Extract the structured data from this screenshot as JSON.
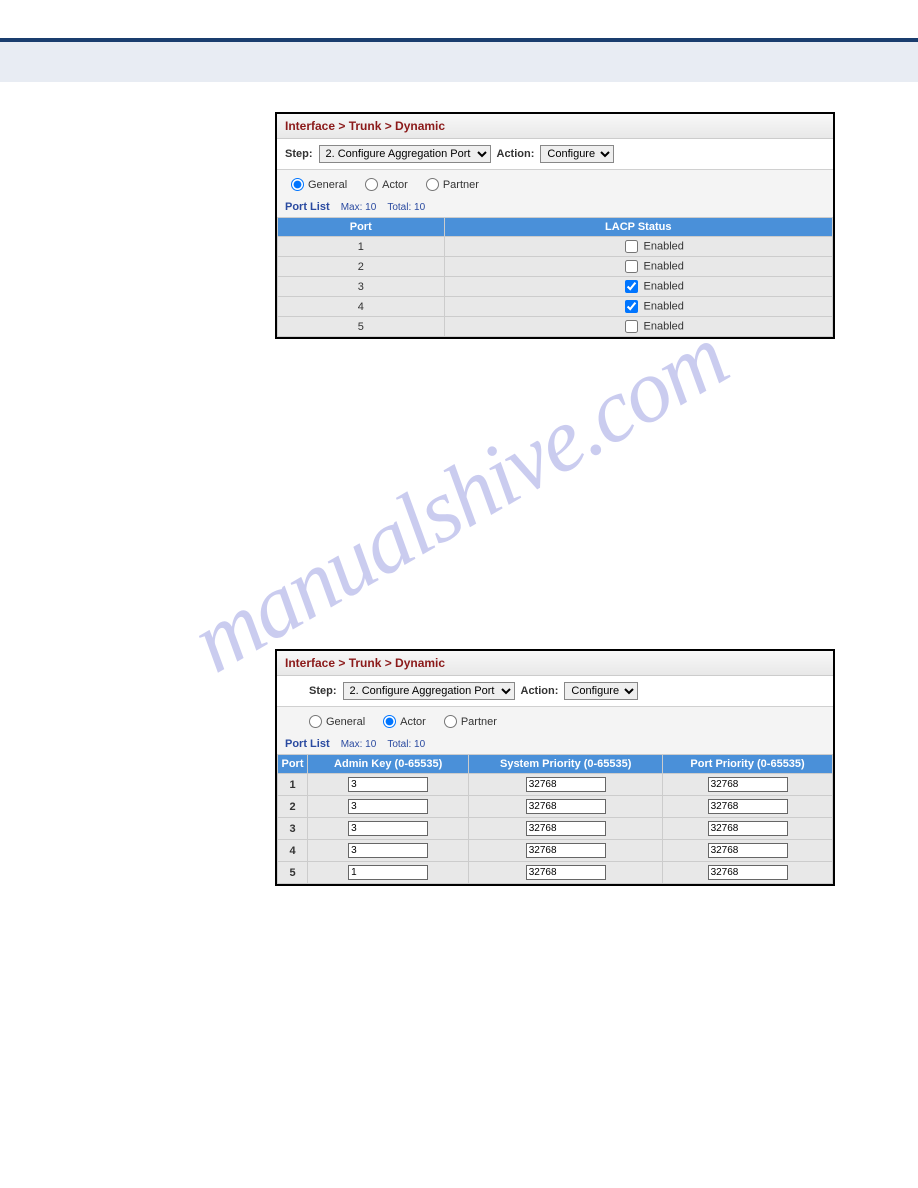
{
  "breadcrumb": "Interface > Trunk > Dynamic",
  "stepbar": {
    "step_label": "Step:",
    "step_value": "2. Configure Aggregation Port",
    "action_label": "Action:",
    "action_value": "Configure"
  },
  "radios": {
    "general": "General",
    "actor": "Actor",
    "partner": "Partner"
  },
  "portlist": {
    "title": "Port List",
    "max": "Max: 10",
    "total": "Total: 10"
  },
  "panel1": {
    "headers": {
      "port": "Port",
      "lacp": "LACP Status"
    },
    "rows": [
      {
        "port": "1",
        "enabled": false,
        "label": "Enabled"
      },
      {
        "port": "2",
        "enabled": false,
        "label": "Enabled"
      },
      {
        "port": "3",
        "enabled": true,
        "label": "Enabled"
      },
      {
        "port": "4",
        "enabled": true,
        "label": "Enabled"
      },
      {
        "port": "5",
        "enabled": false,
        "label": "Enabled"
      }
    ]
  },
  "panel2": {
    "headers": {
      "port": "Port",
      "admin": "Admin Key (0-65535)",
      "sys": "System Priority (0-65535)",
      "pri": "Port Priority (0-65535)"
    },
    "rows": [
      {
        "port": "1",
        "admin": "3",
        "sys": "32768",
        "pri": "32768"
      },
      {
        "port": "2",
        "admin": "3",
        "sys": "32768",
        "pri": "32768"
      },
      {
        "port": "3",
        "admin": "3",
        "sys": "32768",
        "pri": "32768"
      },
      {
        "port": "4",
        "admin": "3",
        "sys": "32768",
        "pri": "32768"
      },
      {
        "port": "5",
        "admin": "1",
        "sys": "32768",
        "pri": "32768"
      }
    ]
  },
  "watermark": "manualshive.com"
}
